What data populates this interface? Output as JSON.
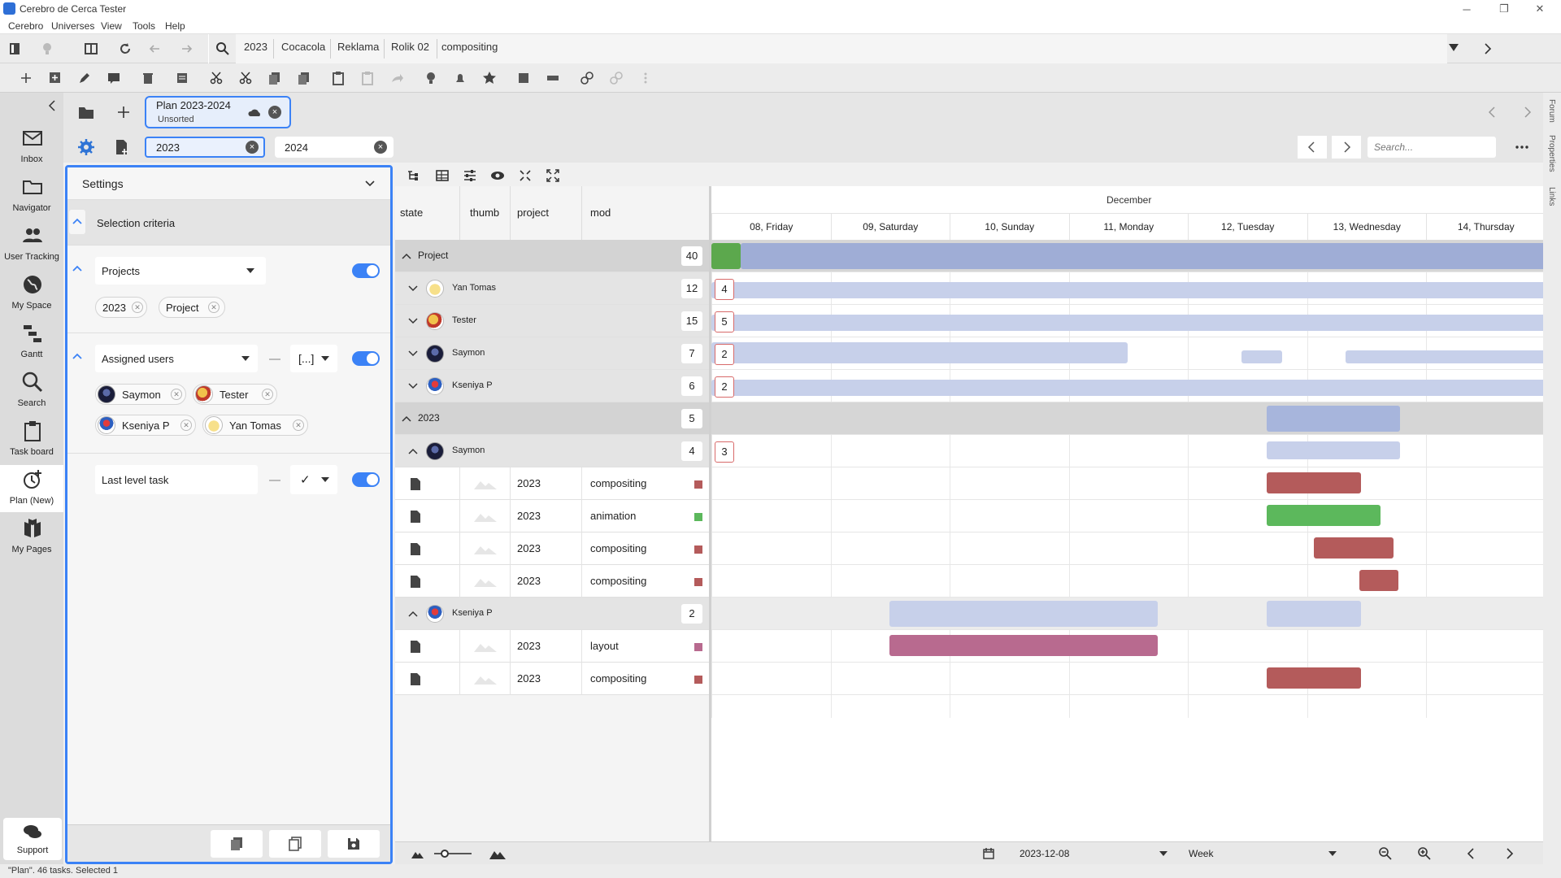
{
  "window": {
    "title": "Cerebro de Cerca  Tester"
  },
  "menu": [
    "Cerebro",
    "Universes",
    "View",
    "Tools",
    "Help"
  ],
  "breadcrumbs": [
    "2023",
    "Cocacola",
    "Reklama",
    "Rolik 02",
    "compositing"
  ],
  "nav": [
    {
      "label": "Inbox",
      "icon": "inbox-icon"
    },
    {
      "label": "Navigator",
      "icon": "folder-icon"
    },
    {
      "label": "User Tracking",
      "icon": "users-icon"
    },
    {
      "label": "My Space",
      "icon": "globe-icon"
    },
    {
      "label": "Gantt",
      "icon": "gantt-icon"
    },
    {
      "label": "Search",
      "icon": "search-icon"
    },
    {
      "label": "Task board",
      "icon": "clipboard-icon"
    },
    {
      "label": "Plan (New)",
      "icon": "plan-icon"
    },
    {
      "label": "My Pages",
      "icon": "books-icon"
    }
  ],
  "support_label": "Support",
  "plan_tab": {
    "title": "Plan 2023-2024",
    "subtitle": "Unsorted"
  },
  "filters": [
    "2023",
    "2024"
  ],
  "search_placeholder": "Search...",
  "settings": {
    "title": "Settings",
    "selection_criteria": "Selection criteria",
    "projects_label": "Projects",
    "project_chips": [
      "2023",
      "Project"
    ],
    "assigned_label": "Assigned users",
    "assigned_op": "[...]",
    "users": [
      "Saymon",
      "Tester",
      "Kseniya P",
      "Yan Tomas"
    ],
    "last_level_label": "Last level task",
    "last_level_op": "✓"
  },
  "columns": [
    "state",
    "thumb",
    "project",
    "mod"
  ],
  "timeline": {
    "month": "December",
    "days": [
      "08, Friday",
      "09, Saturday",
      "10, Sunday",
      "11, Monday",
      "12, Tuesday",
      "13, Wednesday",
      "14, Thursday"
    ]
  },
  "rows": [
    {
      "kind": "group",
      "label": "Project",
      "count": "40"
    },
    {
      "kind": "user",
      "label": "Yan Tomas",
      "count": "12",
      "load": "4"
    },
    {
      "kind": "user",
      "label": "Tester",
      "count": "15",
      "load": "5"
    },
    {
      "kind": "user",
      "label": "Saymon",
      "count": "7",
      "load": "2"
    },
    {
      "kind": "user",
      "label": "Kseniya P",
      "count": "6",
      "load": "2"
    },
    {
      "kind": "group",
      "label": "2023",
      "count": "5"
    },
    {
      "kind": "user",
      "label": "Saymon",
      "count": "4",
      "load": "3"
    },
    {
      "kind": "task",
      "project": "2023",
      "mod": "compositing",
      "color": "#b45b5b"
    },
    {
      "kind": "task",
      "project": "2023",
      "mod": "animation",
      "color": "#5cb85c"
    },
    {
      "kind": "task",
      "project": "2023",
      "mod": "compositing",
      "color": "#b45b5b"
    },
    {
      "kind": "task",
      "project": "2023",
      "mod": "compositing",
      "color": "#b45b5b"
    },
    {
      "kind": "user",
      "label": "Kseniya P",
      "count": "2"
    },
    {
      "kind": "task",
      "project": "2023",
      "mod": "layout",
      "color": "#b86a8f"
    },
    {
      "kind": "task",
      "project": "2023",
      "mod": "compositing",
      "color": "#b45b5b"
    }
  ],
  "bottom": {
    "date": "2023-12-08",
    "scale": "Week"
  },
  "status": "\"Plan\". 46 tasks. Selected 1",
  "right_tabs": [
    "Forum",
    "Properties",
    "Links"
  ],
  "colors": {
    "accent": "#3b82f6",
    "bar_blue": "#a7b5dc",
    "bar_red": "#b45b5b",
    "bar_green": "#5cb85c",
    "bar_pink": "#b86a8f"
  }
}
